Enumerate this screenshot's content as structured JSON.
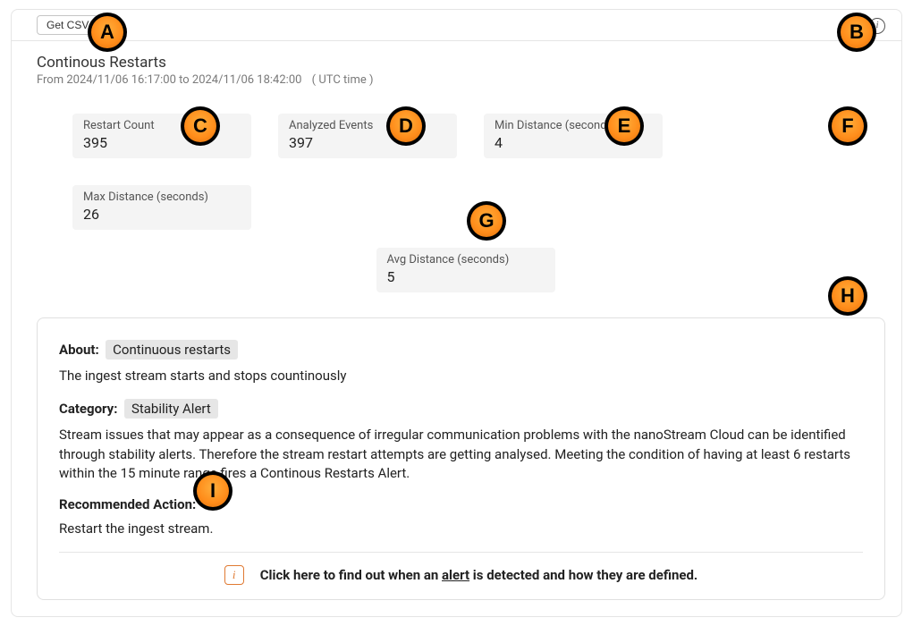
{
  "header": {
    "csv_button": "Get CSV"
  },
  "title": "Continous Restarts",
  "date_range_prefix": "From ",
  "date_from": "2024/11/06 16:17:00",
  "date_to_sep": " to ",
  "date_to": "2024/11/06 18:42:00",
  "utc_note": "( UTC time )",
  "stats": {
    "restart_count": {
      "label": "Restart Count",
      "value": "395"
    },
    "analyzed_events": {
      "label": "Analyzed Events",
      "value": "397"
    },
    "min_distance": {
      "label": "Min Distance (seconds)",
      "value": "4"
    },
    "max_distance": {
      "label": "Max Distance (seconds)",
      "value": "26"
    },
    "avg_distance": {
      "label": "Avg Distance (seconds)",
      "value": "5"
    }
  },
  "about": {
    "about_label": "About:",
    "about_tag": "Continuous restarts",
    "about_text": "The ingest stream starts and stops countinously",
    "category_label": "Category:",
    "category_tag": "Stability Alert",
    "category_text": "Stream issues that may appear as a consequence of irregular communication problems with the nanoStream Cloud can be identified through stability alerts. Therefore the stream restart attempts are getting analysed. Meeting the condition of having at least 6 restarts within the 15 minute range fires a Continous Restarts Alert.",
    "recommended_label": "Recommended Action:",
    "recommended_text": "Restart the ingest stream.",
    "alert_line_pre": "Click here to find out when an ",
    "alert_line_underlined": "alert",
    "alert_line_post": " is detected and how they are defined."
  },
  "badges": [
    "A",
    "B",
    "C",
    "D",
    "E",
    "F",
    "G",
    "H",
    "I"
  ],
  "glyphs": {
    "info": "i",
    "alert_icon": "i"
  }
}
